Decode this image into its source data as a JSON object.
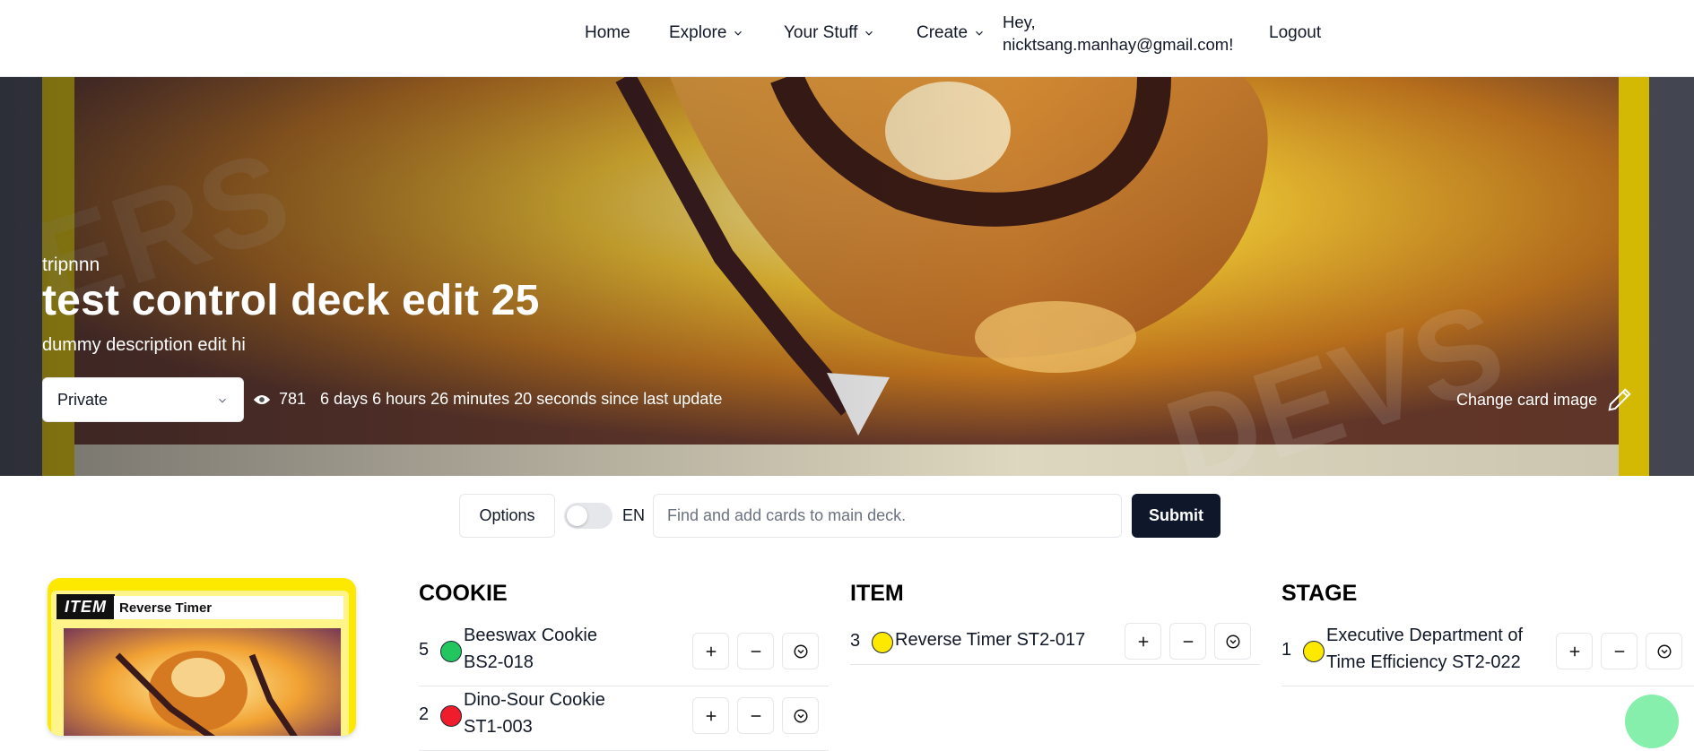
{
  "nav": {
    "home": "Home",
    "explore": "Explore",
    "your_stuff": "Your Stuff",
    "create": "Create",
    "greeting_line1": "Hey,",
    "greeting_line2": "nicktsang.manhay@gmail.com!",
    "logout": "Logout"
  },
  "deck": {
    "author": "tripnnn",
    "title": "test control deck edit 25",
    "description": "dummy description edit hi",
    "privacy": "Private",
    "views": "781",
    "since_update": "6 days 6 hours 26 minutes 20 seconds since last update",
    "change_image_label": "Change card image"
  },
  "search": {
    "options_label": "Options",
    "lang_label": "EN",
    "placeholder": "Find and add cards to main deck.",
    "submit_label": "Submit"
  },
  "card_preview": {
    "type": "ITEM",
    "name": "Reverse Timer"
  },
  "columns": {
    "cookie": {
      "title": "COOKIE",
      "rows": [
        {
          "qty": "5",
          "color": "#22c55e",
          "name_line1": "Beeswax Cookie",
          "name_line2": "BS2-018"
        },
        {
          "qty": "2",
          "color": "#ef1c2b",
          "name_line1": "Dino-Sour Cookie",
          "name_line2": "ST1-003"
        }
      ]
    },
    "item": {
      "title": "ITEM",
      "rows": [
        {
          "qty": "3",
          "color": "#fde900",
          "name_line1": "Reverse Timer ST2-017"
        }
      ]
    },
    "stage": {
      "title": "STAGE",
      "rows": [
        {
          "qty": "1",
          "color": "#fde900",
          "name_line1": "Executive Department of",
          "name_line2": "Time Efficiency ST2-022"
        }
      ]
    }
  },
  "icons": {
    "chevron": "chevron-down-icon",
    "eye": "eye-icon",
    "pencil": "pencil-icon",
    "plus": "plus-icon",
    "minus": "minus-icon",
    "expand": "circle-chevron-down-icon"
  },
  "colors": {
    "primary_button": "#0f172a",
    "card_frame": "#fde900"
  }
}
